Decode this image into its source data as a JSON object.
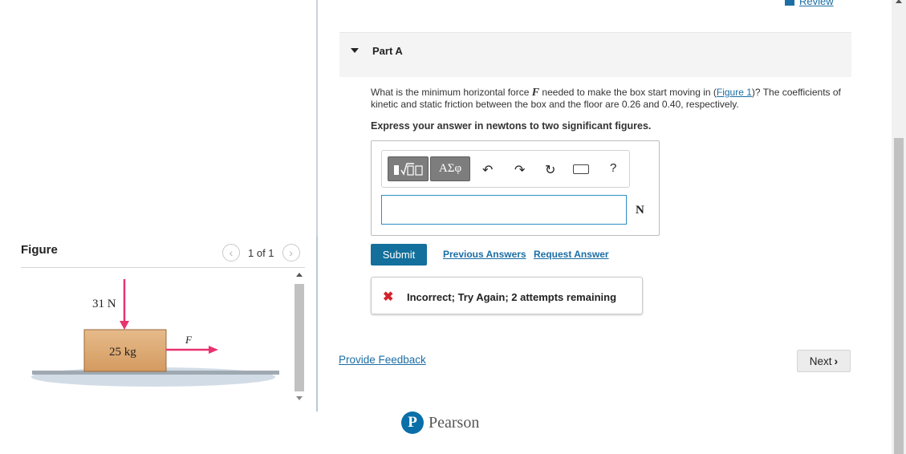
{
  "review": {
    "label": "Review"
  },
  "figure_panel": {
    "title": "Figure",
    "pager": "1 of 1",
    "diagram": {
      "force_down_label": "31 N",
      "mass_label": "25 kg",
      "force_label": "F"
    }
  },
  "part": {
    "title": "Part A"
  },
  "question": {
    "text_before": "What is the minimum horizontal force ",
    "variable": "F",
    "text_middle": " needed to make the box start moving in (",
    "figure_link": "Figure 1",
    "text_after": ")? The coefficients of kinetic and static friction between the box and the floor are 0.26 and 0.40, respectively.",
    "instruction": "Express your answer in newtons to two significant figures."
  },
  "answer": {
    "toolbar": {
      "greek_label": "ΑΣφ",
      "help_label": "?"
    },
    "value": "",
    "unit": "N"
  },
  "actions": {
    "submit_label": "Submit",
    "previous_answers": "Previous Answers",
    "request_answer": "Request Answer"
  },
  "feedback": {
    "message": "Incorrect; Try Again; 2 attempts remaining"
  },
  "footer": {
    "provide_feedback": "Provide Feedback",
    "next_label": "Next",
    "brand": "Pearson"
  },
  "colors": {
    "link": "#1c6ea4",
    "submit_bg": "#136f9c",
    "error": "#d2232a",
    "arrow": "#e8336e",
    "box_fill": "#dca875"
  }
}
